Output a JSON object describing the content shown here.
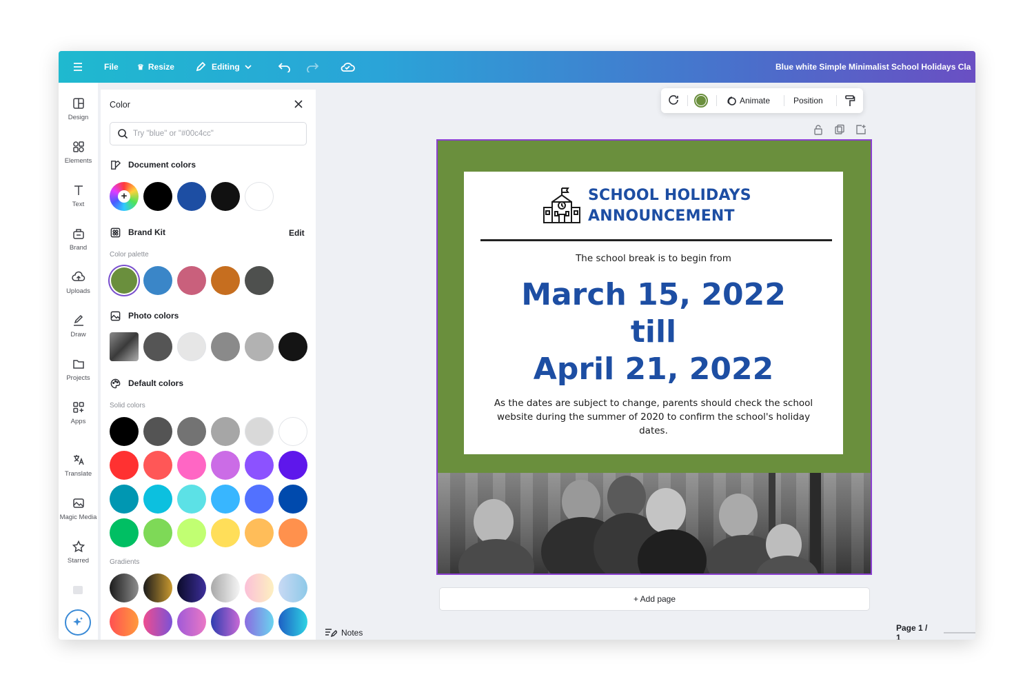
{
  "topbar": {
    "file_label": "File",
    "resize_label": "Resize",
    "editing_label": "Editing",
    "document_title": "Blue white Simple Minimalist School Holidays Cla"
  },
  "rail": {
    "items": [
      {
        "label": "Design",
        "icon": "design-icon"
      },
      {
        "label": "Elements",
        "icon": "elements-icon"
      },
      {
        "label": "Text",
        "icon": "text-icon"
      },
      {
        "label": "Brand",
        "icon": "brand-icon"
      },
      {
        "label": "Uploads",
        "icon": "uploads-icon"
      },
      {
        "label": "Draw",
        "icon": "draw-icon"
      },
      {
        "label": "Projects",
        "icon": "projects-icon"
      },
      {
        "label": "Apps",
        "icon": "apps-icon"
      },
      {
        "label": "Translate",
        "icon": "translate-icon"
      },
      {
        "label": "Magic Media",
        "icon": "magic-media-icon"
      },
      {
        "label": "Starred",
        "icon": "star-icon"
      }
    ]
  },
  "panel": {
    "title": "Color",
    "search_placeholder": "Try \"blue\" or \"#00c4cc\"",
    "document_colors_label": "Document colors",
    "document_colors": [
      "#000000",
      "#1d4ea3",
      "#111111",
      "#ffffff"
    ],
    "brand_kit_label": "Brand Kit",
    "brand_kit_edit": "Edit",
    "color_palette_label": "Color palette",
    "palette": [
      "#6a8f3d",
      "#3a86c8",
      "#c9607c",
      "#c66e1f",
      "#4e504e"
    ],
    "photo_colors_label": "Photo colors",
    "photo_colors": [
      "#555555",
      "#e6e6e6",
      "#8a8a8a",
      "#b2b2b2",
      "#141414"
    ],
    "default_colors_label": "Default colors",
    "solid_colors_label": "Solid colors",
    "solid_colors": [
      [
        "#000000",
        "#545454",
        "#737373",
        "#a6a6a6",
        "#d9d9d9",
        "#ffffff"
      ],
      [
        "#ff3131",
        "#ff5757",
        "#ff66c4",
        "#cb6ce6",
        "#8c52ff",
        "#5e17eb"
      ],
      [
        "#0097b2",
        "#0cc0df",
        "#5ce1e6",
        "#38b6ff",
        "#5271ff",
        "#004aad"
      ],
      [
        "#00bf63",
        "#7ed957",
        "#c1ff72",
        "#ffde59",
        "#ffbd59",
        "#ff914d"
      ]
    ],
    "gradients_label": "Gradients"
  },
  "toolbar": {
    "animate_label": "Animate",
    "position_label": "Position",
    "selected_color": "#6a8f3d"
  },
  "design": {
    "heading_line1": "SCHOOL HOLIDAYS",
    "heading_line2": "ANNOUNCEMENT",
    "lead": "The school break is to begin from",
    "date_start": "March 15, 2022",
    "till": "till",
    "date_end": "April 21, 2022",
    "note": "As the dates are subject to change, parents should check the school website during the summer of 2020 to confirm the school's holiday dates."
  },
  "footer": {
    "add_page_label": "+ Add page",
    "notes_label": "Notes",
    "page_label": "Page 1 / 1"
  }
}
